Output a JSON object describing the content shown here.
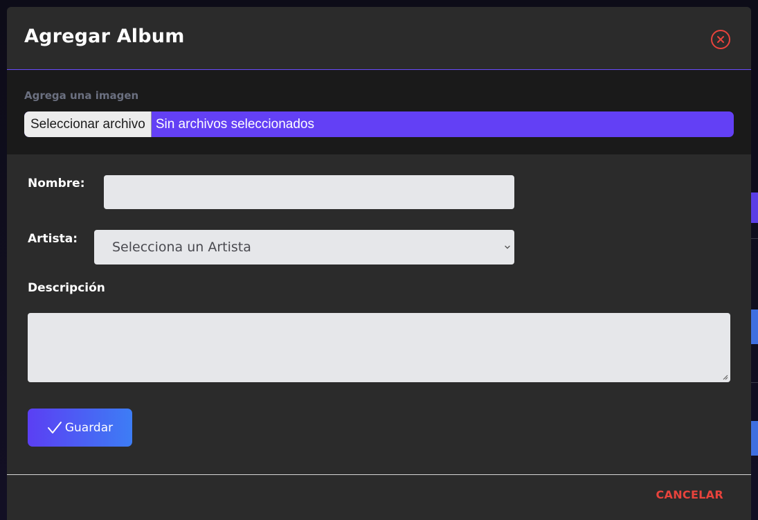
{
  "modal": {
    "title": "Agregar Album"
  },
  "image_upload": {
    "label": "Agrega una imagen",
    "button_label": "Seleccionar archivo",
    "status": "Sin archivos seleccionados"
  },
  "form": {
    "nombre_label": "Nombre:",
    "nombre_value": "",
    "artista_label": "Artista:",
    "artista_selected": "Selecciona un Artista",
    "descripcion_label": "Descripción",
    "descripcion_value": ""
  },
  "actions": {
    "save_label": "Guardar",
    "cancel_label": "CANCELAR"
  },
  "colors": {
    "accent": "#6340f5",
    "danger": "#e8433c",
    "modal_bg": "#2b2b2b",
    "section_bg": "#1a1a1a"
  },
  "icons": {
    "close": "close-circle-icon",
    "save": "check-icon",
    "select": "chevron-down-icon"
  }
}
